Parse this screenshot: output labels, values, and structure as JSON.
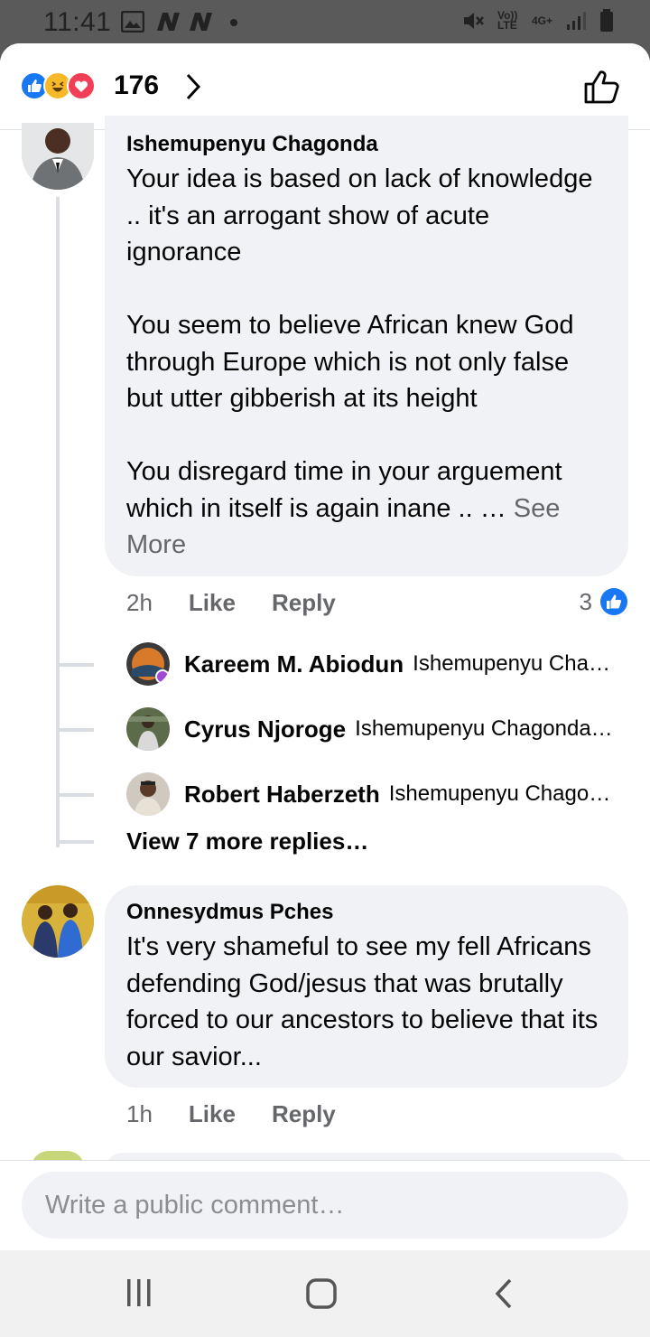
{
  "status_bar": {
    "time": "11:41",
    "network_label": "Vo)) LTE",
    "network_type": "4G+",
    "icons": [
      "gallery-icon",
      "n-app-icon",
      "n-app-icon",
      "dot-icon",
      "mute-icon",
      "signal-icon",
      "battery-icon"
    ]
  },
  "reactions": {
    "count": "176",
    "types": [
      "like",
      "haha",
      "love"
    ]
  },
  "comments": [
    {
      "author": "Ishemupenyu Chagonda",
      "text": "Your idea is based on lack of knowledge .. it's an arrogant show of acute ignorance\n\nYou seem to believe African knew God through Europe which is not only false but utter gibberish at its height\n\nYou disregard time in your arguement which in itself is again inane .. … ",
      "see_more": "See More",
      "time": "2h",
      "like_label": "Like",
      "reply_label": "Reply",
      "like_count": "3",
      "replies": [
        {
          "name": "Kareem M. Abiodun",
          "snippet": "Ishemupenyu Cha…"
        },
        {
          "name": "Cyrus Njoroge",
          "snippet": "Ishemupenyu Chagonda…"
        },
        {
          "name": "Robert Haberzeth",
          "snippet": "Ishemupenyu Chago…"
        }
      ],
      "view_more": "View 7 more replies…"
    },
    {
      "author": "Onnesydmus Pches",
      "text": "It's very shameful to see my fell Africans defending God/jesus that was brutally forced to our ancestors to believe that its our savior...",
      "time": "1h",
      "like_label": "Like",
      "reply_label": "Reply"
    }
  ],
  "composer": {
    "placeholder": "Write a public comment…"
  },
  "colors": {
    "facebook_blue": "#1877f2",
    "bubble_bg": "#f0f2f5",
    "secondary_text": "#65676b"
  }
}
